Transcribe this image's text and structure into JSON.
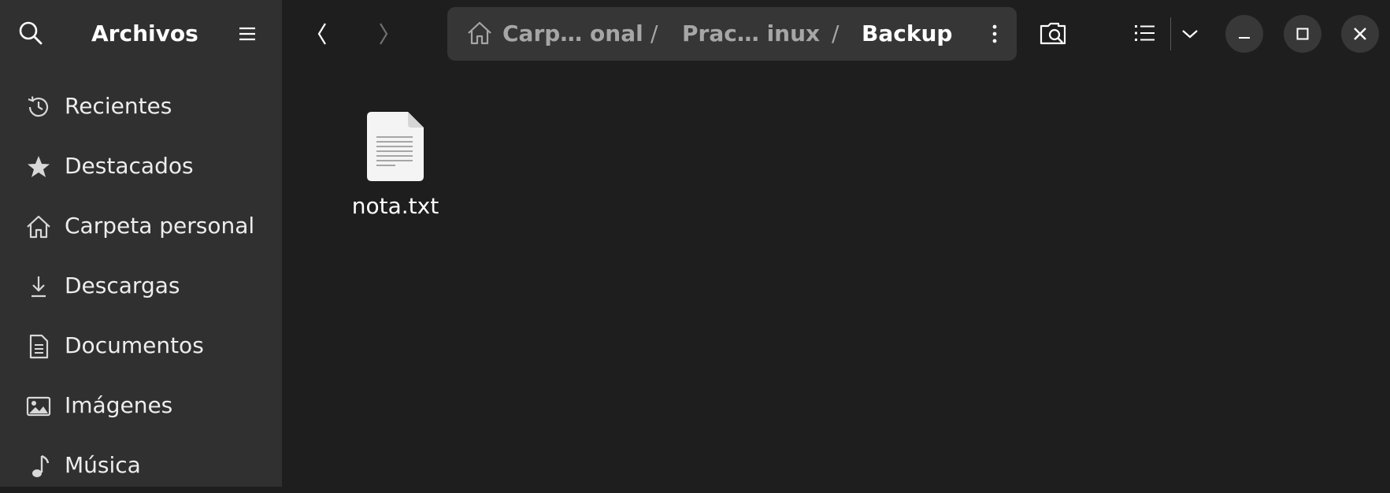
{
  "sidebar": {
    "title": "Archivos",
    "items": [
      {
        "label": "Recientes",
        "icon": "clock-history-icon"
      },
      {
        "label": "Destacados",
        "icon": "star-icon"
      },
      {
        "label": "Carpeta personal",
        "icon": "home-icon"
      },
      {
        "label": "Descargas",
        "icon": "download-icon"
      },
      {
        "label": "Documentos",
        "icon": "document-icon"
      },
      {
        "label": "Imágenes",
        "icon": "image-icon"
      },
      {
        "label": "Música",
        "icon": "music-icon"
      }
    ]
  },
  "pathbar": {
    "crumbs": [
      "Carp… onal",
      "Prac… inux",
      "Backup"
    ],
    "separator": "/"
  },
  "files": [
    {
      "name": "nota.txt",
      "icon": "text-file-icon"
    }
  ],
  "colors": {
    "background": "#1e1e1e",
    "sidebar": "#303030",
    "pathbar": "#363636",
    "window_button": "#383838"
  }
}
